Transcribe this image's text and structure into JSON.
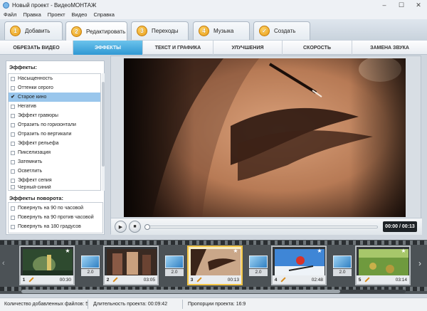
{
  "window": {
    "title": "Новый проект - ВидеоМОНТАЖ",
    "controls": [
      "–",
      "☐",
      "✕"
    ]
  },
  "menu": [
    "Файл",
    "Правка",
    "Проект",
    "Видео",
    "Справка"
  ],
  "main_tabs": [
    {
      "num": "1",
      "label": "Добавить"
    },
    {
      "num": "2",
      "label": "Редактировать"
    },
    {
      "num": "3",
      "label": "Переходы"
    },
    {
      "num": "4",
      "label": "Музыка"
    },
    {
      "num": "✓",
      "label": "Создать"
    }
  ],
  "sub_tabs": [
    "ОБРЕЗАТЬ ВИДЕО",
    "ЭФФЕКТЫ",
    "ТЕКСТ И ГРАФИКА",
    "УЛУЧШЕНИЯ",
    "СКОРОСТЬ",
    "ЗАМЕНА ЗВУКА"
  ],
  "effects": {
    "title": "Эффекты:",
    "items": [
      "Насыщенность",
      "Оттенки серого",
      "Старое кино",
      "Негатив",
      "Эффект гравюры",
      "Отразить по горизонтали",
      "Отразить по вертикали",
      "Эффект рельефа",
      "Пикселизация",
      "Затемнить",
      "Осветлить",
      "Эффект сепия",
      "Черный-синий"
    ],
    "selected": "Старое кино"
  },
  "rotation": {
    "title": "Эффекты поворота:",
    "items": [
      "Повернуть на 90 по часовой",
      "Повернуть на 90 против часовой",
      "Повернуть на 180 градусов"
    ]
  },
  "player": {
    "time": "00:00 / 00:13",
    "progress": 0.0
  },
  "timeline": {
    "clips": [
      {
        "num": "1",
        "duration": "00:30"
      },
      {
        "num": "2",
        "duration": "03:05"
      },
      {
        "num": "3",
        "duration": "00:13"
      },
      {
        "num": "4",
        "duration": "02:48"
      },
      {
        "num": "5",
        "duration": "03:14"
      }
    ],
    "transitions": [
      "2.0",
      "2.0",
      "2.0",
      "2.0"
    ]
  },
  "status": {
    "files": "Количество добавленных файлов: 5",
    "duration": "Длительность проекта:  00:09:42",
    "ratio": "Пропорции проекта:  16:9"
  },
  "colors": {
    "accent": "#2f98d3",
    "selection": "#99c6ec",
    "step_badge": "#e79a13",
    "timeline_bg": "#4c5256",
    "selected_clip": "#f3c545"
  }
}
